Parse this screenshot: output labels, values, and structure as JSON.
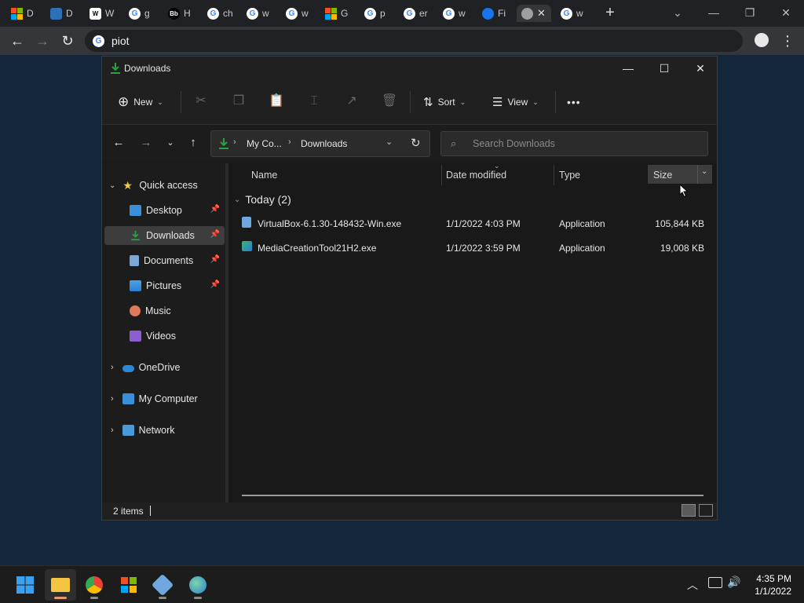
{
  "browser": {
    "tabs": [
      {
        "title": "D",
        "icon": "microsoft-icon"
      },
      {
        "title": "D",
        "icon": "docs-icon"
      },
      {
        "title": "W",
        "icon": "wiki-icon"
      },
      {
        "title": "g",
        "icon": "google-icon"
      },
      {
        "title": "H",
        "icon": "bb-icon"
      },
      {
        "title": "ch",
        "icon": "google-icon"
      },
      {
        "title": "w",
        "icon": "google-icon"
      },
      {
        "title": "w",
        "icon": "google-icon"
      },
      {
        "title": "G",
        "icon": "microsoft-icon"
      },
      {
        "title": "p",
        "icon": "google-icon"
      },
      {
        "title": "er",
        "icon": "google-icon"
      },
      {
        "title": "w",
        "icon": "google-icon"
      },
      {
        "title": "Fi",
        "icon": "edge-icon"
      },
      {
        "title": "",
        "icon": "globe-icon",
        "active": true
      },
      {
        "title": "w",
        "icon": "google-icon"
      }
    ],
    "new_tab": "+",
    "omnibox_text": "piot"
  },
  "explorer": {
    "title": "Downloads",
    "commands": {
      "new": "New",
      "sort": "Sort",
      "view": "View",
      "more": "•••"
    },
    "breadcrumb": [
      "My Co...",
      "Downloads"
    ],
    "search_placeholder": "Search Downloads",
    "sidebar": {
      "quick_access": "Quick access",
      "items": [
        {
          "label": "Desktop",
          "pinned": true
        },
        {
          "label": "Downloads",
          "pinned": true,
          "selected": true
        },
        {
          "label": "Documents",
          "pinned": true
        },
        {
          "label": "Pictures",
          "pinned": true
        },
        {
          "label": "Music",
          "pinned": false
        },
        {
          "label": "Videos",
          "pinned": false
        }
      ],
      "onedrive": "OneDrive",
      "my_computer": "My Computer",
      "network": "Network"
    },
    "columns": {
      "name": "Name",
      "date": "Date modified",
      "type": "Type",
      "size": "Size"
    },
    "group_header": "Today (2)",
    "files": [
      {
        "name": "VirtualBox-6.1.30-148432-Win.exe",
        "date": "1/1/2022 4:03 PM",
        "type": "Application",
        "size": "105,844 KB"
      },
      {
        "name": "MediaCreationTool21H2.exe",
        "date": "1/1/2022 3:59 PM",
        "type": "Application",
        "size": "19,008 KB"
      }
    ],
    "status_count": "2 items"
  },
  "taskbar": {
    "clock_time": "4:35 PM",
    "clock_date": "1/1/2022"
  },
  "colors": {
    "accent_download": "#2ea043",
    "desktop_bg": "#13263a",
    "selection": "#3d3d3d"
  }
}
